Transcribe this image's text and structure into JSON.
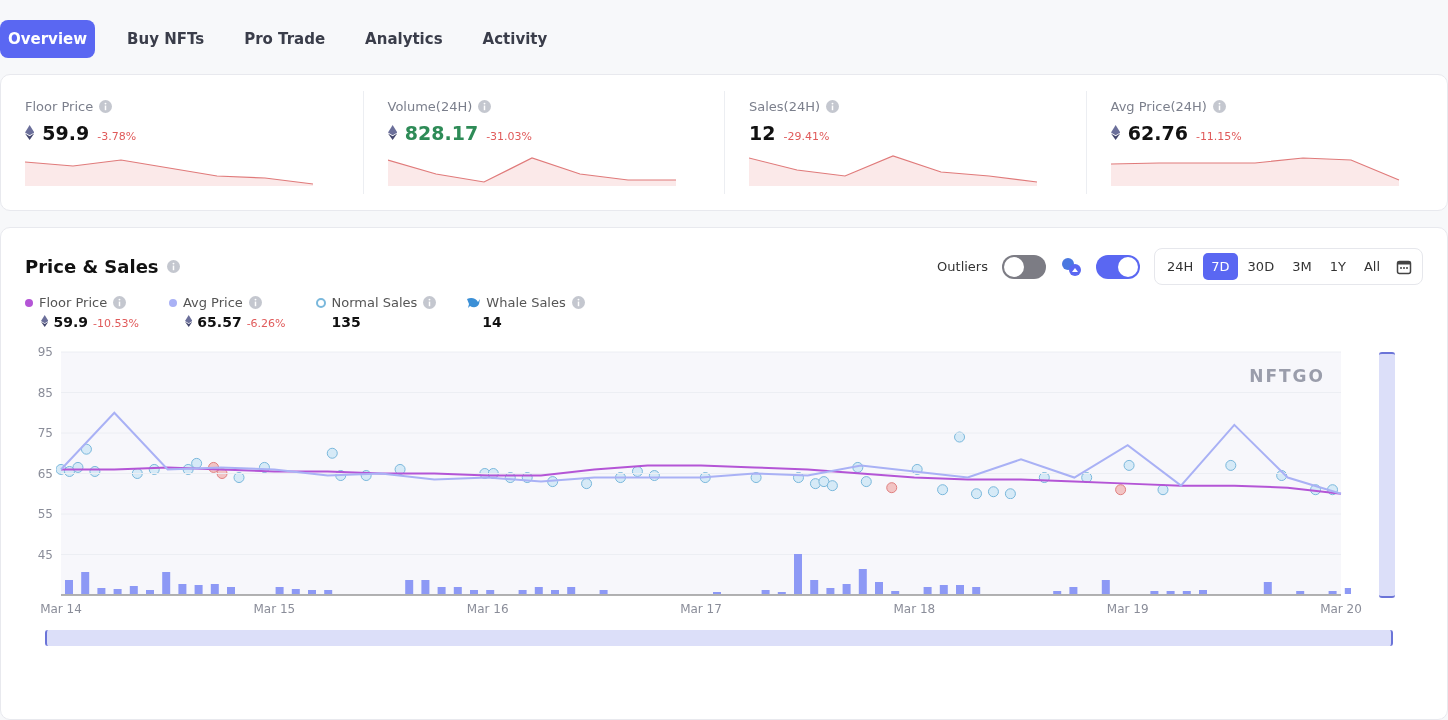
{
  "tabs": [
    {
      "label": "Overview",
      "selected": true
    },
    {
      "label": "Buy NFTs",
      "selected": false
    },
    {
      "label": "Pro Trade",
      "selected": false
    },
    {
      "label": "Analytics",
      "selected": false
    },
    {
      "label": "Activity",
      "selected": false
    }
  ],
  "stats": [
    {
      "label": "Floor Price",
      "eth": true,
      "value": "59.9",
      "change": "-3.78%",
      "highlighted": false
    },
    {
      "label": "Volume(24H)",
      "eth": true,
      "value": "828.17",
      "change": "-31.03%",
      "highlighted": true
    },
    {
      "label": "Sales(24H)",
      "eth": false,
      "value": "12",
      "change": "-29.41%",
      "highlighted": false
    },
    {
      "label": "Avg Price(24H)",
      "eth": true,
      "value": "62.76",
      "change": "-11.15%",
      "highlighted": false
    }
  ],
  "price_sales": {
    "title": "Price & Sales",
    "outliers": {
      "label": "Outliers",
      "on": false
    },
    "whale_toggle": {
      "on": true
    },
    "ranges": [
      {
        "label": "24H",
        "selected": false
      },
      {
        "label": "7D",
        "selected": true
      },
      {
        "label": "30D",
        "selected": false
      },
      {
        "label": "3M",
        "selected": false
      },
      {
        "label": "1Y",
        "selected": false
      },
      {
        "label": "All",
        "selected": false
      }
    ],
    "vertical_range": {
      "level": 1
    },
    "horizontal_range": {
      "level": 1
    },
    "legend": [
      {
        "kind": "dot",
        "color": "#b455d6",
        "eth": true,
        "value": "59.9",
        "change": "-10.53%"
      },
      {
        "kind": "dot",
        "color": "#a9b1f5",
        "eth": true,
        "value": "65.57",
        "change": "-6.26%"
      },
      {
        "kind": "ring",
        "label": "Normal Sales",
        "color": "#7ab8dc",
        "eth": false,
        "value": "135"
      },
      {
        "kind": "whale",
        "label": "Whale Sales",
        "color": "#3b8fd6",
        "eth": false,
        "value": "14"
      }
    ],
    "watermark": "NFTGO",
    "chart_data": {
      "type": "line",
      "categories": [
        "Mar 14",
        null,
        null,
        null,
        "Mar 15",
        null,
        null,
        null,
        "Mar 16",
        null,
        null,
        null,
        "Mar 17",
        null,
        null,
        null,
        "Mar 18",
        null,
        null,
        null,
        "Mar 19",
        null,
        null,
        null,
        "Mar 20"
      ],
      "yticks": [
        45,
        55,
        65,
        75,
        85,
        95
      ],
      "ylim": [
        35,
        95
      ],
      "grid": true,
      "series": [
        {
          "name": "Floor Price",
          "color": "#b455d6",
          "values": [
            66,
            66,
            66.5,
            66,
            65.5,
            65.5,
            65,
            65,
            64.5,
            64.5,
            66,
            67,
            67,
            66.5,
            66,
            65,
            64,
            63.5,
            63.5,
            63,
            62.5,
            62,
            62,
            61.5,
            60
          ]
        },
        {
          "name": "Avg Price",
          "color": "#a9b1f5",
          "values": [
            66,
            80,
            66,
            66.5,
            66,
            64.5,
            65,
            63.5,
            64,
            63,
            64,
            64,
            64,
            65,
            64.5,
            67,
            65.5,
            64,
            68.5,
            64,
            72,
            62,
            77,
            64,
            60
          ]
        }
      ]
    }
  }
}
